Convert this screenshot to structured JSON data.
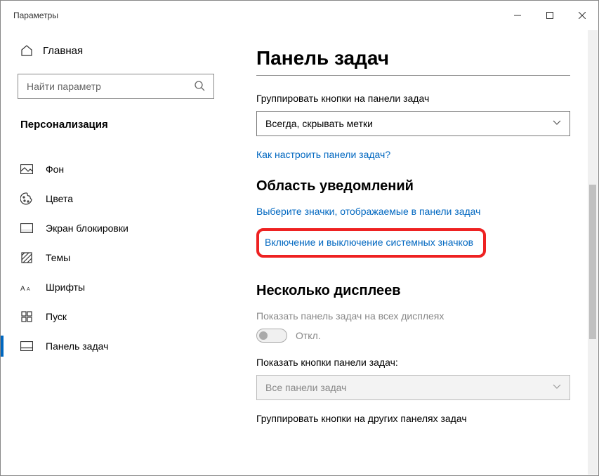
{
  "window": {
    "title": "Параметры"
  },
  "sidebar": {
    "home": "Главная",
    "search_placeholder": "Найти параметр",
    "category": "Персонализация",
    "items": [
      {
        "label": "Фон"
      },
      {
        "label": "Цвета"
      },
      {
        "label": "Экран блокировки"
      },
      {
        "label": "Темы"
      },
      {
        "label": "Шрифты"
      },
      {
        "label": "Пуск"
      },
      {
        "label": "Панель задач"
      }
    ]
  },
  "content": {
    "title": "Панель задач",
    "group_label": "Группировать кнопки на панели задач",
    "group_value": "Всегда, скрывать метки",
    "help_link": "Как настроить панели задач?",
    "section_notif": "Область уведомлений",
    "link_icons": "Выберите значки, отображаемые в панели задач",
    "link_sysicons": "Включение и выключение системных значков",
    "section_multi": "Несколько дисплеев",
    "multi_show_label": "Показать панель задач на всех дисплеях",
    "toggle_off": "Откл.",
    "show_buttons_label": "Показать кнопки панели задач:",
    "show_buttons_value": "Все панели задач",
    "group_other_label": "Группировать кнопки на других панелях задач"
  }
}
